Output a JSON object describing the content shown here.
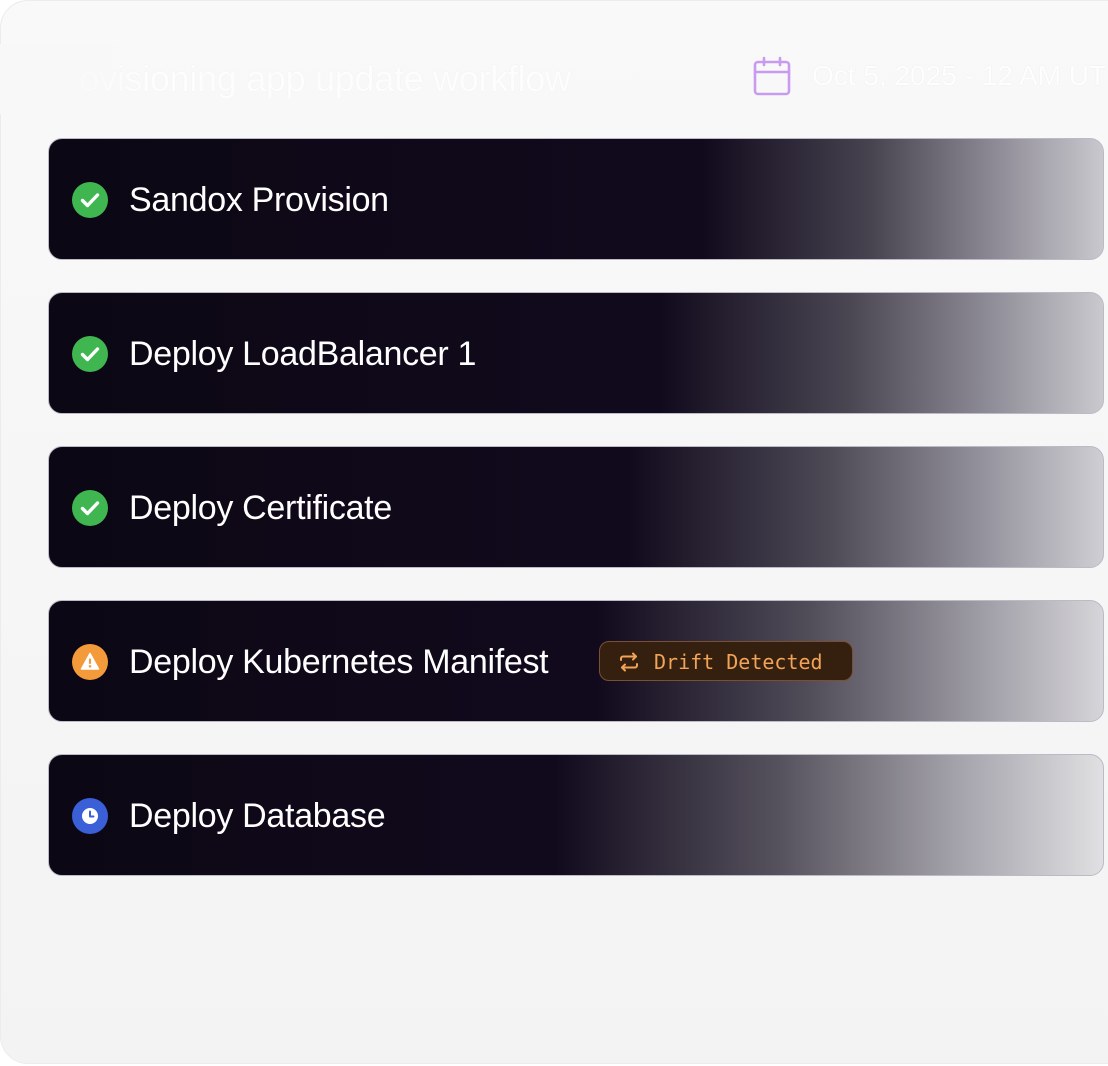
{
  "header": {
    "title": "Provisioning app update workflow",
    "date": "Oct 5, 2025 - 12 AM UT"
  },
  "steps": [
    {
      "label": "Sandox Provision",
      "status": "success"
    },
    {
      "label": "Deploy LoadBalancer 1",
      "status": "success"
    },
    {
      "label": "Deploy Certificate",
      "status": "success"
    },
    {
      "label": "Deploy Kubernetes Manifest",
      "status": "warning",
      "badge": "Drift Detected"
    },
    {
      "label": "Deploy Database",
      "status": "pending"
    }
  ],
  "colors": {
    "success": "#3fb650",
    "warning": "#f39b3b",
    "pending": "#3b5fd6",
    "calendar": "#c89af0",
    "badge_text": "#f2a356"
  },
  "icons": {
    "header": "calendar-icon",
    "success": "check-circle-icon",
    "warning": "warning-icon",
    "pending": "clock-icon",
    "badge": "refresh-icon"
  }
}
